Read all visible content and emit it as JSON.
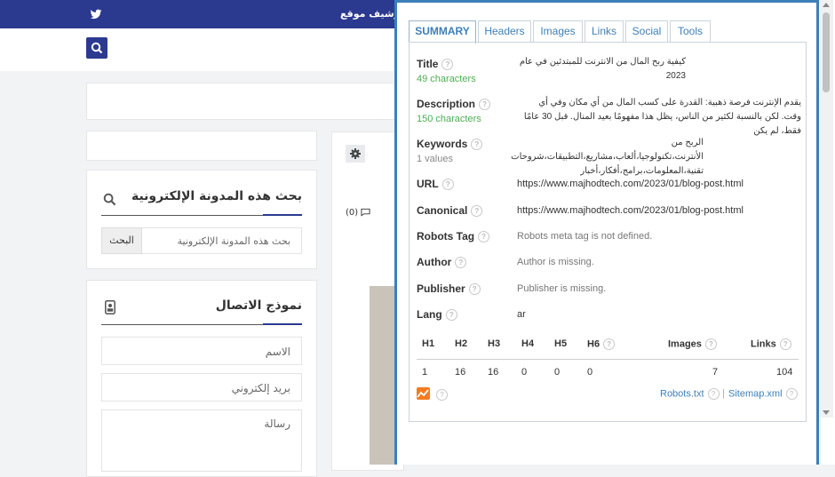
{
  "page": {
    "topbar": {
      "archive_label": "ارشيف موقع",
      "social_icon": "twitter-icon"
    },
    "search_widget": {
      "title": "بحث هذه المدونة الإلكترونية",
      "placeholder": "بحث هذه المدونة الإلكترونية",
      "button": "البحث"
    },
    "contact_widget": {
      "title": "نموذج الاتصال",
      "name_placeholder": "الاسم",
      "email_placeholder": "بريد إلكتروني",
      "message_placeholder": "رسالة"
    },
    "post": {
      "comments": "(0)"
    }
  },
  "seo": {
    "tabs": [
      "SUMMARY",
      "Headers",
      "Images",
      "Links",
      "Social",
      "Tools"
    ],
    "title": {
      "label": "Title",
      "sub": "49 characters",
      "value": "كيفية ربح المال من الانترنت للمبتدئين في عام 2023"
    },
    "description": {
      "label": "Description",
      "sub": "150 characters",
      "value": "يقدم الإنترنت فرصة ذهبية: القدرة على كسب المال من أي مكان وفي أي وقت. لكن بالنسبة لكثير من الناس، يظل هذا مفهومًا بعيد المنال. قبل 30 عامًا فقط، لم يكن"
    },
    "keywords": {
      "label": "Keywords",
      "sub": "1 values",
      "value": "الربح من الأنترنت،تكنولوجيا،ألعاب،مشاريع،التطبيقات،شروحات تقنية،المعلومات،برامج،أفكار،أخبار"
    },
    "url": {
      "label": "URL",
      "value": "https://www.majhodtech.com/2023/01/blog-post.html"
    },
    "canonical": {
      "label": "Canonical",
      "value": "https://www.majhodtech.com/2023/01/blog-post.html"
    },
    "robots": {
      "label": "Robots Tag",
      "value": "Robots meta tag is not defined."
    },
    "author": {
      "label": "Author",
      "value": "Author is missing."
    },
    "publisher": {
      "label": "Publisher",
      "value": "Publisher is missing."
    },
    "lang": {
      "label": "Lang",
      "value": "ar"
    },
    "headings": {
      "labels": [
        "H1",
        "H2",
        "H3",
        "H4",
        "H5",
        "H6"
      ],
      "values": [
        "1",
        "16",
        "16",
        "0",
        "0",
        "0"
      ],
      "images_label": "Images",
      "images_value": "7",
      "links_label": "Links",
      "links_value": "104"
    },
    "robots_txt": "Robots.txt",
    "sitemap": "Sitemap.xml",
    "help_glyph": "?"
  }
}
